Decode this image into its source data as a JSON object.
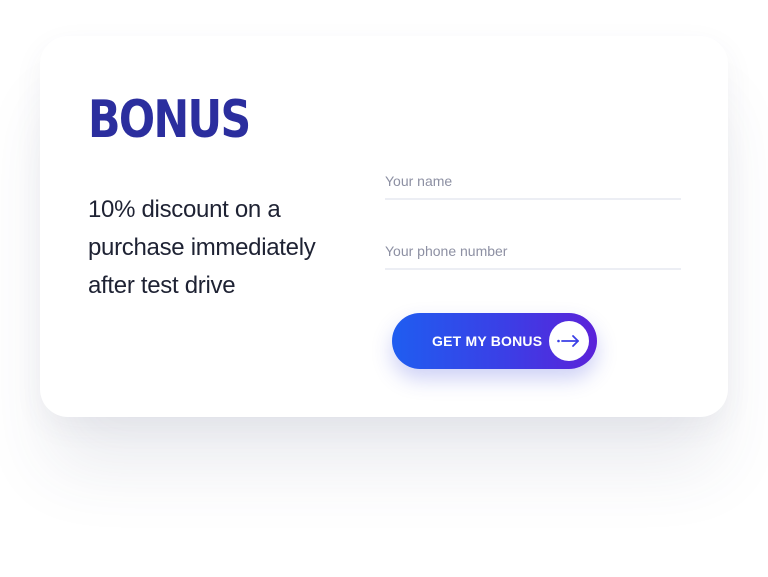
{
  "promo": {
    "title": "BONUS",
    "description": "10% discount on a purchase immediately after test drive"
  },
  "form": {
    "name_placeholder": "Your name",
    "name_value": "",
    "phone_placeholder": "Your phone number",
    "phone_value": "",
    "submit_label": "GET MY BONUS",
    "submit_icon": "arrow-right-icon"
  },
  "colors": {
    "title": "#2b2e9e",
    "button_gradient_start": "#1f5df0",
    "button_gradient_end": "#5b22d9",
    "text": "#1e2233"
  }
}
